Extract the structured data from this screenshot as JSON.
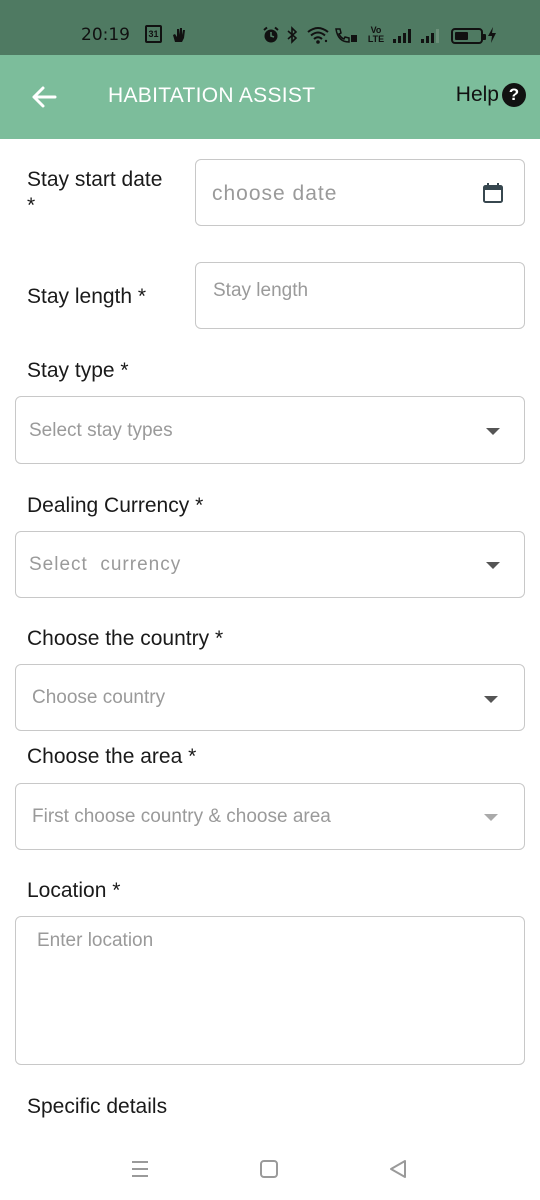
{
  "status_bar": {
    "time": "20:19",
    "calendar_day": "31",
    "network_label_top": "Vo",
    "network_label_bottom": "LTE",
    "battery_level": 0.55
  },
  "app_bar": {
    "title": "HABITATION ASSIST",
    "help_label": "Help",
    "help_glyph": "?",
    "background": "#7cbd9b"
  },
  "form": {
    "stay_start_date": {
      "label_line1": "Stay start date",
      "label_line2": "*",
      "placeholder": "choose date",
      "icon": "calendar-icon"
    },
    "stay_length": {
      "label": "Stay length *",
      "placeholder": "Stay length"
    },
    "stay_type": {
      "label": "Stay type *",
      "placeholder": "Select stay types"
    },
    "dealing_currency": {
      "label": "Dealing Currency *",
      "placeholder": "Select  currency"
    },
    "country": {
      "label": "Choose the country *",
      "placeholder": "Choose country"
    },
    "area": {
      "label": "Choose the area *",
      "placeholder": "First choose country & choose area"
    },
    "location": {
      "label": "Location *",
      "placeholder": "Enter location"
    },
    "specific_details": {
      "label": "Specific details"
    }
  },
  "nav_bar": {
    "recents": "menu-icon",
    "home": "square-icon",
    "back": "triangle-back-icon"
  }
}
